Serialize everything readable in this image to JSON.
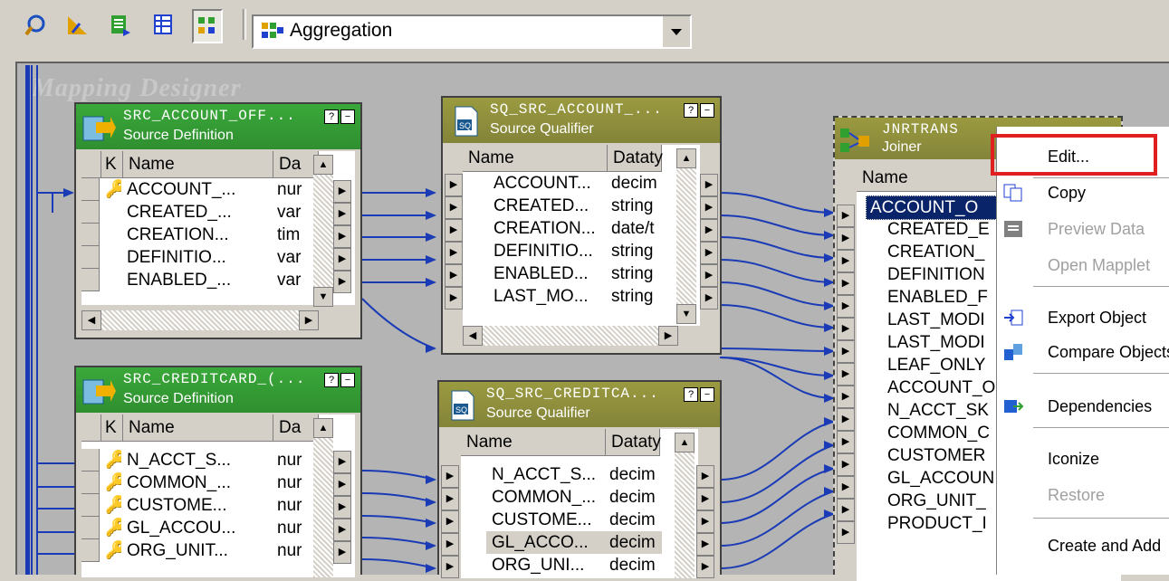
{
  "toolbar": {
    "buttons": [
      "source-analyzer-icon",
      "target-designer-icon",
      "transformation-developer-icon",
      "mapplet-designer-icon",
      "mapping-designer-icon"
    ],
    "combo_label": "Aggregation"
  },
  "canvas": {
    "watermark": "Mapping Designer"
  },
  "src_account": {
    "title": "SRC_ACCOUNT_OFF...",
    "type": "Source Definition",
    "cols": [
      "K",
      "Name",
      "Da"
    ],
    "rows": [
      {
        "key": "key",
        "name": "ACCOUNT_...",
        "type": "nur"
      },
      {
        "key": "",
        "name": "CREATED_...",
        "type": "var"
      },
      {
        "key": "",
        "name": "CREATION...",
        "type": "tim"
      },
      {
        "key": "",
        "name": "DEFINITIO...",
        "type": "var"
      },
      {
        "key": "",
        "name": "ENABLED_...",
        "type": "var"
      }
    ]
  },
  "sq_account": {
    "title": "SQ_SRC_ACCOUNT_...",
    "type": "Source Qualifier",
    "cols": [
      "Name",
      "Dataty"
    ],
    "rows": [
      {
        "name": "ACCOUNT...",
        "type": "decim"
      },
      {
        "name": "CREATED...",
        "type": "string"
      },
      {
        "name": "CREATION...",
        "type": "date/t"
      },
      {
        "name": "DEFINITIO...",
        "type": "string"
      },
      {
        "name": "ENABLED...",
        "type": "string"
      },
      {
        "name": "LAST_MO...",
        "type": "string"
      }
    ]
  },
  "src_credit": {
    "title": "SRC_CREDITCARD_(...",
    "type": "Source Definition",
    "cols": [
      "K",
      "Name",
      "Da"
    ],
    "rows": [
      {
        "key": "key",
        "name": "N_ACCT_S...",
        "type": "nur"
      },
      {
        "key": "key",
        "name": "COMMON_...",
        "type": "nur"
      },
      {
        "key": "key",
        "name": "CUSTOME...",
        "type": "nur"
      },
      {
        "key": "key",
        "name": "GL_ACCOU...",
        "type": "nur"
      },
      {
        "key": "key",
        "name": "ORG_UNIT...",
        "type": "nur"
      }
    ]
  },
  "sq_credit": {
    "title": "SQ_SRC_CREDITCA...",
    "type": "Source Qualifier",
    "cols": [
      "Name",
      "Dataty"
    ],
    "rows": [
      {
        "name": "N_ACCT_S...",
        "type": "decim"
      },
      {
        "name": "COMMON_...",
        "type": "decim"
      },
      {
        "name": "CUSTOME...",
        "type": "decim"
      },
      {
        "name": "GL_ACCO...",
        "type": "decim"
      },
      {
        "name": "ORG_UNI...",
        "type": "decim"
      }
    ]
  },
  "joiner": {
    "title": "JNRTRANS",
    "type": "Joiner",
    "col": "Name",
    "rows": [
      "ACCOUNT_O",
      "CREATED_E",
      "CREATION_",
      "DEFINITION",
      "ENABLED_F",
      "LAST_MODI",
      "LAST_MODI",
      "LEAF_ONLY",
      "ACCOUNT_O",
      "N_ACCT_SK",
      "COMMON_C",
      "CUSTOMER",
      "GL_ACCOUN",
      "ORG_UNIT_",
      "PRODUCT_I"
    ]
  },
  "context_menu": {
    "items": [
      {
        "label": "Edit...",
        "icon": "",
        "disabled": false
      },
      {
        "label": "Copy",
        "icon": "copy-icon",
        "disabled": false
      },
      {
        "label": "Preview Data",
        "icon": "preview-icon",
        "disabled": true
      },
      {
        "label": "Open Mapplet",
        "icon": "",
        "disabled": true
      },
      {
        "label": "Export Object",
        "icon": "export-icon",
        "disabled": false
      },
      {
        "label": "Compare Objects",
        "icon": "compare-icon",
        "disabled": false
      },
      {
        "label": "Dependencies",
        "icon": "dependencies-icon",
        "disabled": false
      },
      {
        "label": "Iconize",
        "icon": "",
        "disabled": false
      },
      {
        "label": "Restore",
        "icon": "",
        "disabled": true
      },
      {
        "label": "Create and Add",
        "icon": "",
        "disabled": false
      }
    ]
  }
}
